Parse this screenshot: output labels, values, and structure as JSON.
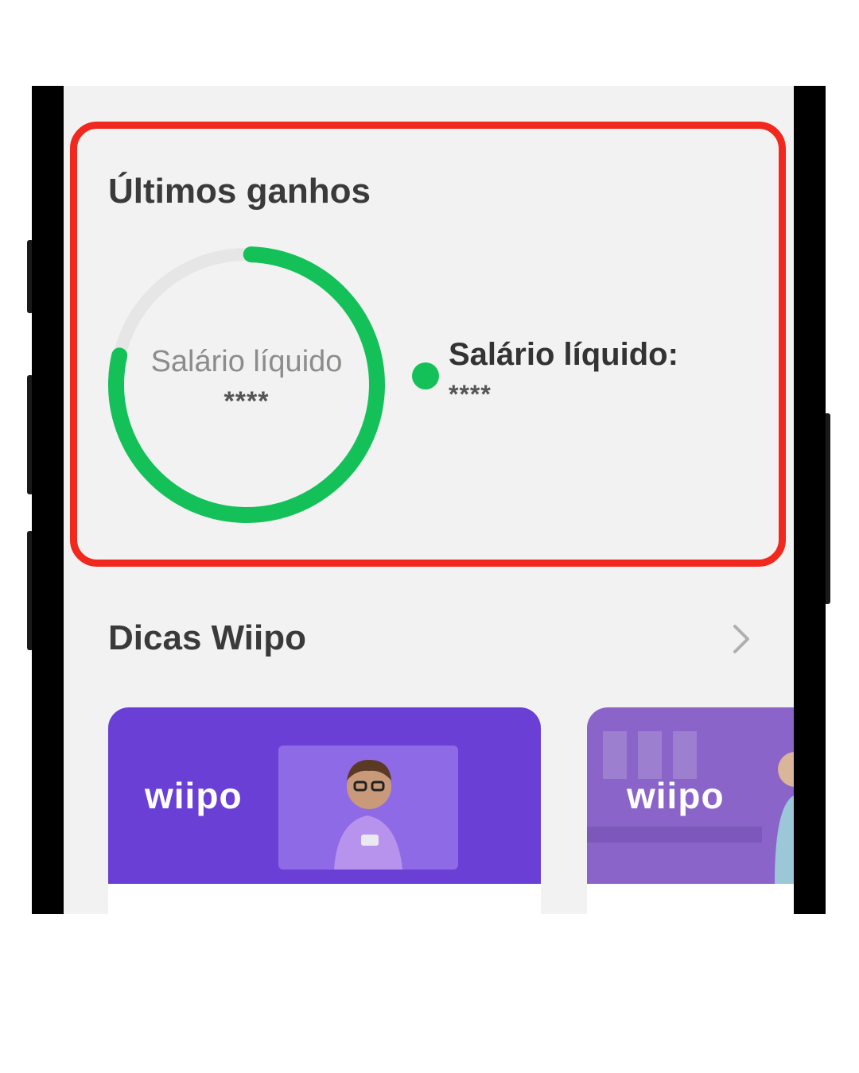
{
  "earnings": {
    "title": "Últimos ganhos",
    "donut_label": "Salário líquido",
    "donut_value": "****",
    "legend_label": "Salário líquido:",
    "legend_value": "****",
    "progress_fraction": 0.78,
    "accent_color": "#14c159",
    "track_color": "#e6e6e6"
  },
  "tips": {
    "title": "Dicas Wiipo",
    "chevron_icon": "chevron-right-icon",
    "cards": [
      {
        "brand": "wiipo",
        "color": "#6a3fd6"
      },
      {
        "brand": "wiipo",
        "color": "#8a64c8"
      }
    ]
  },
  "highlight_color": "#f0281e"
}
